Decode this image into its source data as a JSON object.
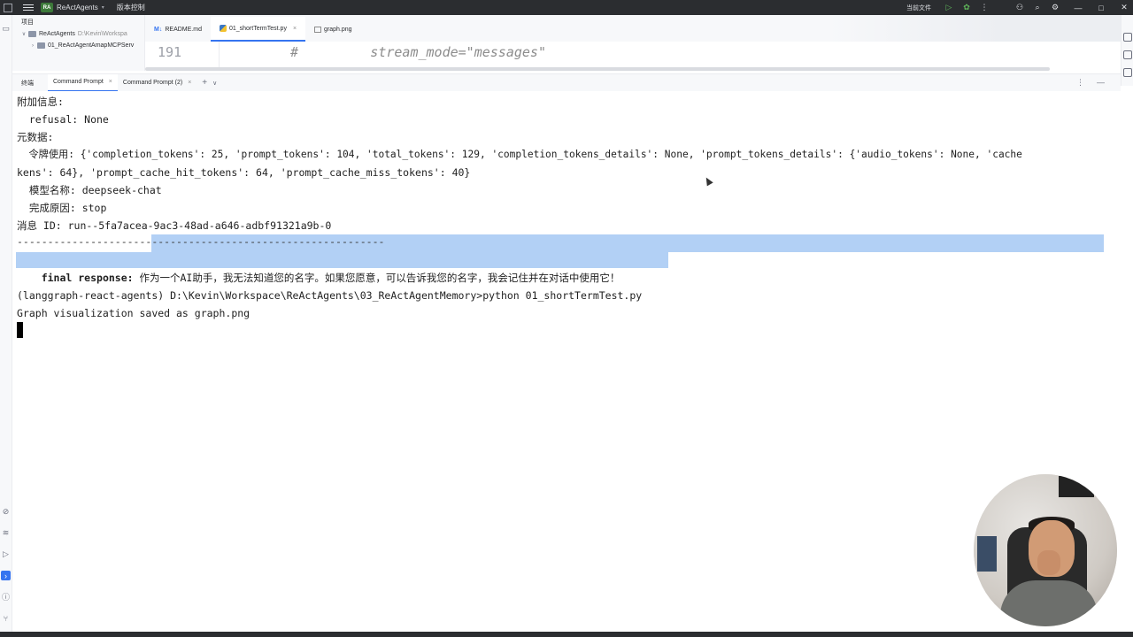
{
  "window": {
    "logo_text": "RA",
    "project_name": "ReActAgents",
    "vcs_label": "版本控制",
    "run_config": "当前文件",
    "icons": [
      "menu-icon",
      "run-icon",
      "debug-icon",
      "more-icon",
      "add-user-icon",
      "search-icon",
      "settings-icon",
      "minimize-icon",
      "maximize-icon",
      "close-icon"
    ]
  },
  "project": {
    "header": "项目",
    "root_name": "ReActAgents",
    "root_path": "D:\\Kevin\\Workspa",
    "child_name": "01_ReActAgentAmapMCPServ"
  },
  "editor": {
    "tabs": [
      {
        "icon": "M↓",
        "label": "README.md"
      },
      {
        "label": "01_shortTermTest.py"
      },
      {
        "label": "graph.png"
      }
    ],
    "line_number": "191",
    "code": "#         stream_mode=\"messages\""
  },
  "terminal": {
    "title": "终端",
    "tabs": [
      {
        "label": "Command Prompt"
      },
      {
        "label": "Command Prompt (2)"
      }
    ],
    "plus": "+",
    "lines": {
      "l1": "附加信息:",
      "l2": "  refusal: None",
      "l3": "元数据:",
      "l4": "  令牌使用: {'completion_tokens': 25, 'prompt_tokens': 104, 'total_tokens': 129, 'completion_tokens_details': None, 'prompt_tokens_details': {'audio_tokens': None, 'cache",
      "l5": "kens': 64}, 'prompt_cache_hit_tokens': 64, 'prompt_cache_miss_tokens': 40}",
      "l6": "  模型名称: deepseek-chat",
      "l7": "  完成原因: stop",
      "l8": "消息 ID: run--5fa7acea-9ac3-48ad-a646-adbf91321a9b-0",
      "l9": "------------------------------------------------------------",
      "l10_label": "final response:",
      "l10_text": " 作为一个AI助手，我无法知道您的名字。如果您愿意，可以告诉我您的名字，我会记住并在对话中使用它！",
      "l11": "(langgraph-react-agents) D:\\Kevin\\Workspace\\ReActAgents\\03_ReActAgentMemory>python 01_shortTermTest.py",
      "l12": "Graph visualization saved as graph.png"
    }
  },
  "colors": {
    "selection": "#b2d0f5",
    "accent": "#3574f0",
    "titlebar": "#2b2d30"
  }
}
